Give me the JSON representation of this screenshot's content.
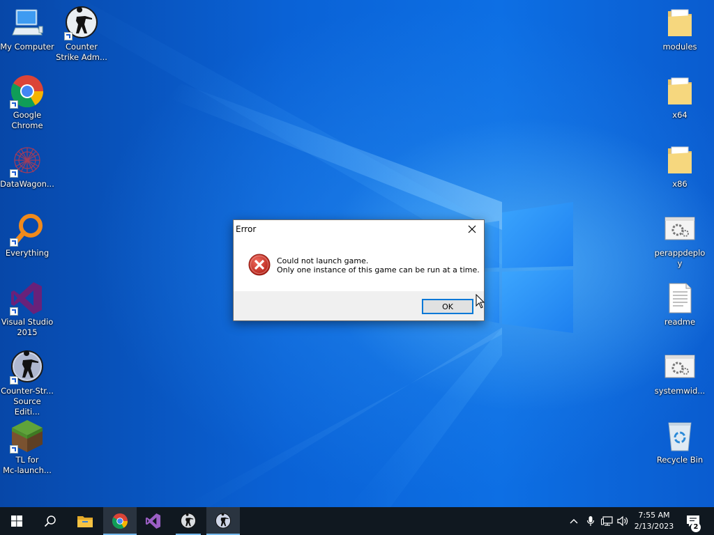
{
  "desktop": {
    "left_icons": [
      {
        "name": "my-computer",
        "label": "My Computer",
        "icon": "computer-icon"
      },
      {
        "name": "counter-strike-admin",
        "label": "Counter\nStrike Adm...",
        "icon": "counter-strike-icon"
      },
      {
        "name": "google-chrome",
        "label": "Google\nChrome",
        "icon": "chrome-icon"
      },
      {
        "name": "datawagon",
        "label": "DataWagon...",
        "icon": "datawagon-icon"
      },
      {
        "name": "everything",
        "label": "Everything",
        "icon": "everything-search-icon"
      },
      {
        "name": "visual-studio-2015",
        "label": "Visual Studio\n2015",
        "icon": "visual-studio-icon"
      },
      {
        "name": "counter-strike-source",
        "label": "Counter-Str...\nSource Editi...",
        "icon": "counter-strike-source-icon"
      },
      {
        "name": "tl-mc-launcher",
        "label": "TL for\nMc-launch...",
        "icon": "minecraft-grass-block-icon"
      }
    ],
    "right_icons": [
      {
        "name": "modules",
        "label": "modules",
        "icon": "folder-icon"
      },
      {
        "name": "x64",
        "label": "x64",
        "icon": "folder-icon"
      },
      {
        "name": "x86",
        "label": "x86",
        "icon": "folder-icon"
      },
      {
        "name": "perappdeploy",
        "label": "perappdeploy",
        "icon": "settings-file-icon"
      },
      {
        "name": "readme",
        "label": "readme",
        "icon": "text-file-icon"
      },
      {
        "name": "systemwide",
        "label": "systemwid...",
        "icon": "settings-file-icon"
      },
      {
        "name": "recycle-bin",
        "label": "Recycle Bin",
        "icon": "recycle-bin-icon"
      }
    ]
  },
  "dialog": {
    "title": "Error",
    "message_line1": "Could not launch game.",
    "message_line2": "Only one instance of this game can be run at a time.",
    "ok_label": "OK",
    "icon": "error-icon"
  },
  "taskbar": {
    "apps": [
      {
        "name": "start-button",
        "icon": "windows-logo-icon"
      },
      {
        "name": "search-button",
        "icon": "search-icon"
      },
      {
        "name": "file-explorer-button",
        "icon": "file-explorer-icon"
      },
      {
        "name": "chrome-taskbar-button",
        "icon": "chrome-icon"
      },
      {
        "name": "visual-studio-taskbar-button",
        "icon": "visual-studio-icon"
      },
      {
        "name": "counter-strike-taskbar-button",
        "icon": "counter-strike-icon"
      },
      {
        "name": "counter-strike-source-taskbar-button",
        "icon": "counter-strike-source-icon"
      }
    ],
    "time": "7:55 AM",
    "date": "2/13/2023",
    "notification_count": "2",
    "colors": {
      "taskbar_bg": "#101820",
      "accent": "#0078d7",
      "error_red": "#c42b1c"
    }
  }
}
